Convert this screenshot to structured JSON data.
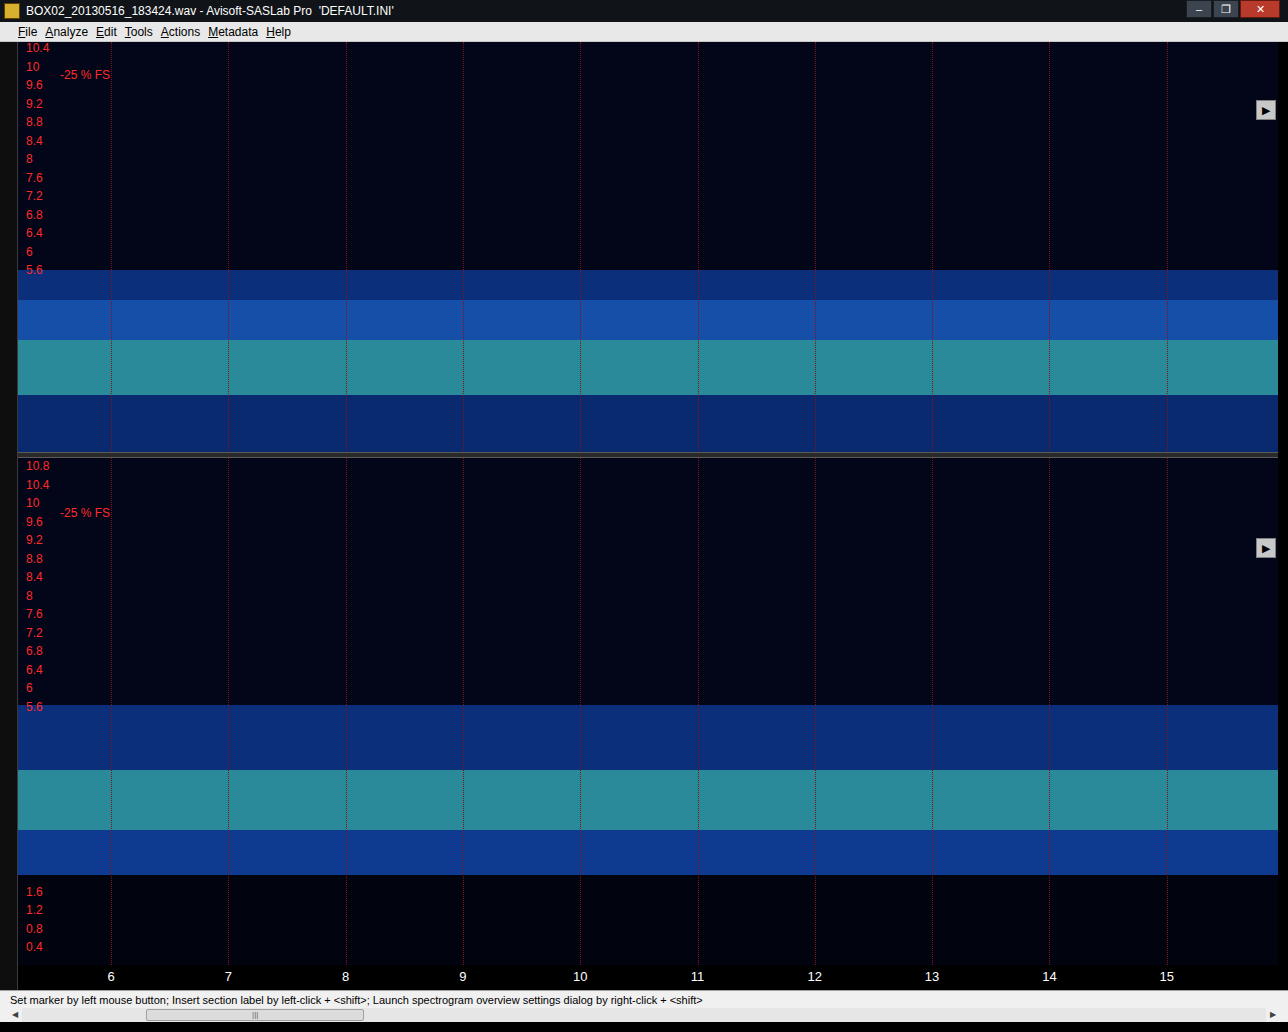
{
  "window": {
    "title": "BOX02_20130516_183424.wav - Avisoft-SASLab Pro  'DEFAULT.INI'",
    "controls": [
      "‒",
      "❐",
      "✕"
    ]
  },
  "menu": [
    {
      "label": "File",
      "mnemonic": 0
    },
    {
      "label": "Analyze",
      "mnemonic": 0
    },
    {
      "label": "Edit",
      "mnemonic": 0
    },
    {
      "label": "Tools",
      "mnemonic": 0
    },
    {
      "label": "Actions",
      "mnemonic": 0
    },
    {
      "label": "Metadata",
      "mnemonic": 0
    },
    {
      "label": "Help",
      "mnemonic": 0
    }
  ],
  "panels": [
    {
      "level_label": "-25 % FS",
      "play": "▶",
      "ticks": [
        "10.4",
        "10",
        "9.6",
        "9.2",
        "8.8",
        "8.4",
        "8",
        "7.6",
        "7.2",
        "6.8",
        "6.4",
        "6",
        "5.6"
      ]
    },
    {
      "level_label": "-25 % FS",
      "play": "▶",
      "ticks": [
        "10.8",
        "10.4",
        "10",
        "9.6",
        "9.2",
        "8.8",
        "8.4",
        "8",
        "7.6",
        "7.2",
        "6.8",
        "6.4",
        "6",
        "5.6",
        "1.6",
        "1.2",
        "0.8",
        "0.4"
      ]
    }
  ],
  "time_axis": {
    "ticks": [
      "6",
      "7",
      "8",
      "9",
      "10",
      "11",
      "12",
      "13",
      "14",
      "15"
    ]
  },
  "status_bar": "Set marker by left mouse button; Insert section label by left-click + <shift>; Launch spectrogram overview settings dialog by right-click + <shift>",
  "scrollbar": {
    "left": "◀",
    "right": "▶",
    "grip": "|||",
    "level": 0.1,
    "thumb": 0.175
  }
}
